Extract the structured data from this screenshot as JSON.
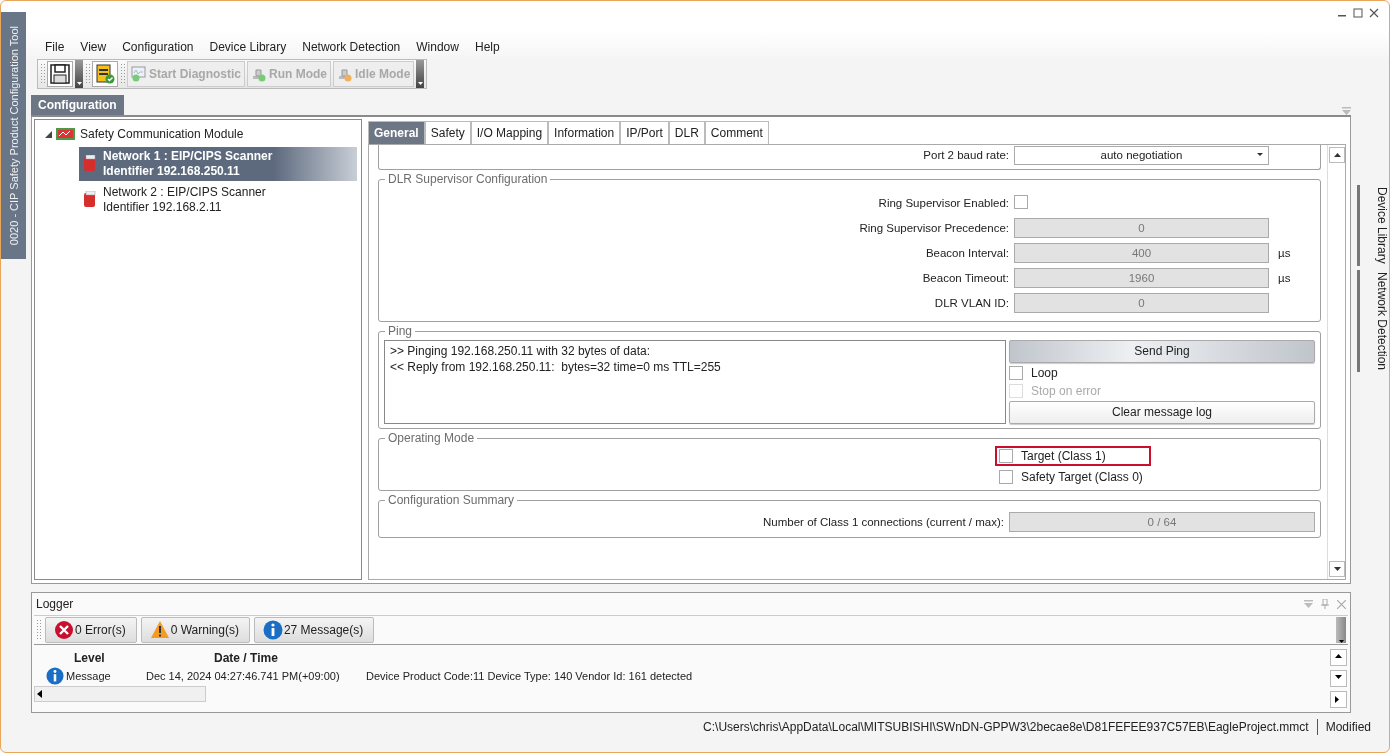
{
  "side_tab": "0020 - CIP Safety Product Configuration Tool",
  "menu": [
    "File",
    "View",
    "Configuration",
    "Device Library",
    "Network Detection",
    "Window",
    "Help"
  ],
  "toolbar": [
    {
      "kind": "save"
    },
    {
      "kind": "device"
    },
    {
      "kind": "diagnostic",
      "label": "Start Diagnostic",
      "disabled": true
    },
    {
      "kind": "run",
      "label": "Run Mode",
      "disabled": true
    },
    {
      "kind": "idle",
      "label": "Idle Mode",
      "disabled": true
    }
  ],
  "document_tab": "Configuration",
  "tree": {
    "label": "Safety Communication Module",
    "expanded": true,
    "children": [
      {
        "label": "Network 1 : EIP/CIPS Scanner",
        "sublabel": "Identifier 192.168.250.11",
        "selected": true
      },
      {
        "label": "Network 2 : EIP/CIPS Scanner",
        "sublabel": "Identifier 192.168.2.11",
        "selected": false
      }
    ]
  },
  "tabs": [
    {
      "label": "General",
      "selected": true
    },
    {
      "label": "Safety",
      "selected": false
    },
    {
      "label": "I/O Mapping",
      "selected": false
    },
    {
      "label": "Information",
      "selected": false
    },
    {
      "label": "IP/Port",
      "selected": false
    },
    {
      "label": "DLR",
      "selected": false
    },
    {
      "label": "Comment",
      "selected": false
    }
  ],
  "port_row": {
    "label": "Port 2 baud rate:",
    "value": "auto negotiation"
  },
  "dlr": {
    "title": "DLR Supervisor Configuration",
    "rows": [
      {
        "kind": "checkbox",
        "label": "Ring Supervisor Enabled:",
        "checked": false
      },
      {
        "kind": "field",
        "label": "Ring Supervisor Precedence:",
        "value": "0",
        "disabled": true
      },
      {
        "kind": "field",
        "label": "Beacon Interval:",
        "value": "400",
        "unit": "µs",
        "disabled": true
      },
      {
        "kind": "field",
        "label": "Beacon Timeout:",
        "value": "1960",
        "unit": "µs",
        "disabled": true
      },
      {
        "kind": "field",
        "label": "DLR VLAN ID:",
        "value": "0",
        "disabled": true
      }
    ]
  },
  "ping": {
    "title": "Ping",
    "log": [
      ">> Pinging 192.168.250.11 with 32 bytes of data:",
      "<< Reply from 192.168.250.11:  bytes=32 time=0 ms TTL=255"
    ],
    "send_button": "Send Ping",
    "options": [
      {
        "label": "Loop",
        "checked": false,
        "disabled": false
      },
      {
        "label": "Stop on error",
        "checked": false,
        "disabled": true
      }
    ],
    "clear_button": "Clear message log"
  },
  "operating_mode": {
    "title": "Operating Mode",
    "options": [
      {
        "label": "Target (Class 1)",
        "checked": false,
        "highlighted": true
      },
      {
        "label": "Safety Target (Class 0)",
        "checked": false,
        "highlighted": false
      }
    ]
  },
  "summary": {
    "title": "Configuration Summary",
    "label": "Number of Class 1 connections (current / max):",
    "value": "0 / 64",
    "disabled": true
  },
  "right_tabs": [
    "Device Library",
    "Network Detection"
  ],
  "logger": {
    "title": "Logger",
    "filters": [
      {
        "kind": "error",
        "label": "0 Error(s)"
      },
      {
        "kind": "warning",
        "label": "0 Warning(s)"
      },
      {
        "kind": "info",
        "label": "27 Message(s)"
      }
    ],
    "columns": [
      "Level",
      "Date / Time"
    ],
    "rows": [
      {
        "kind": "info",
        "level": "Message",
        "time": "Dec 14, 2024 04:27:46.741 PM(+09:00)",
        "text": "Device Product Code:11 Device Type: 140 Vendor Id: 161 detected"
      }
    ]
  },
  "status_bar": {
    "path": "C:\\Users\\chris\\AppData\\Local\\MITSUBISHI\\SWnDN-GPPW3\\2becae8e\\D81FEFEE937C57EB\\EagleProject.mmct",
    "state": "Modified"
  }
}
